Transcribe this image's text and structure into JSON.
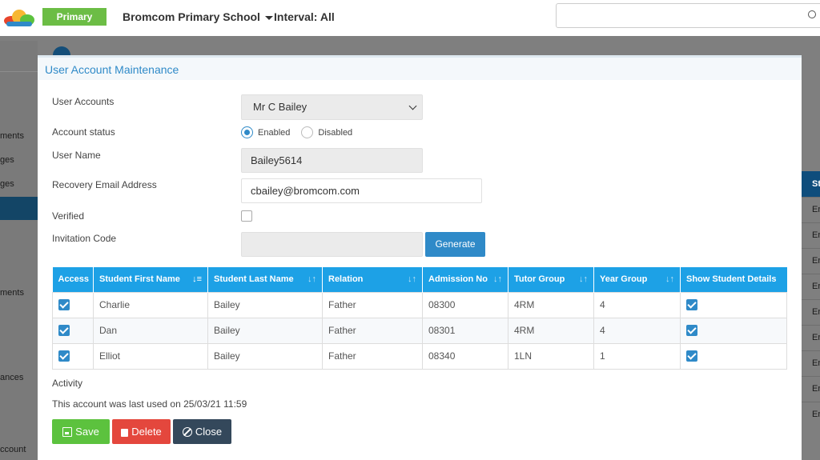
{
  "topbar": {
    "logo": "cloud-logo",
    "badge": "Primary",
    "school": "Bromcom Primary School",
    "interval": "Interval: All",
    "search_icon": "search-icon"
  },
  "background": {
    "nav_items": [
      "ments",
      "ges",
      "ges",
      "ments",
      "ances",
      "ccount"
    ],
    "right_header": "St",
    "right_rows": [
      "Er",
      "Er",
      "Er",
      "Er",
      "Er",
      "Er",
      "Er",
      "Er",
      "Er"
    ]
  },
  "modal": {
    "title": "User Account Maintenance",
    "user_accounts_label": "User Accounts",
    "user_accounts_value": "Mr C Bailey",
    "account_status_label": "Account status",
    "status_enabled": "Enabled",
    "status_disabled": "Disabled",
    "status_selected": "Enabled",
    "user_name_label": "User Name",
    "user_name_value": "Bailey5614",
    "recovery_email_label": "Recovery Email Address",
    "recovery_email_value": "cbailey@bromcom.com",
    "verified_label": "Verified",
    "verified_checked": false,
    "invitation_code_label": "Invitation Code",
    "invitation_code_value": "",
    "generate_label": "Generate",
    "table": {
      "headers": [
        "Access",
        "Student First Name",
        "Student Last Name",
        "Relation",
        "Admission No",
        "Tutor Group",
        "Year Group",
        "Show Student Details"
      ],
      "rows": [
        {
          "access": true,
          "first": "Charlie",
          "last": "Bailey",
          "relation": "Father",
          "admission": "08300",
          "tutor": "4RM",
          "year": "4",
          "show": true
        },
        {
          "access": true,
          "first": "Dan",
          "last": "Bailey",
          "relation": "Father",
          "admission": "08301",
          "tutor": "4RM",
          "year": "4",
          "show": true
        },
        {
          "access": true,
          "first": "Elliot",
          "last": "Bailey",
          "relation": "Father",
          "admission": "08340",
          "tutor": "1LN",
          "year": "1",
          "show": true
        }
      ]
    },
    "activity_label": "Activity",
    "last_used_text": "This account was last used on 25/03/21 11:59",
    "buttons": {
      "save": "Save",
      "delete": "Delete",
      "close": "Close"
    }
  },
  "colors": {
    "accent": "#2f8ac8",
    "table_header": "#1da1e6",
    "save": "#5cc23e",
    "delete": "#e4473d",
    "close": "#34485b",
    "badge": "#6cbd45"
  }
}
